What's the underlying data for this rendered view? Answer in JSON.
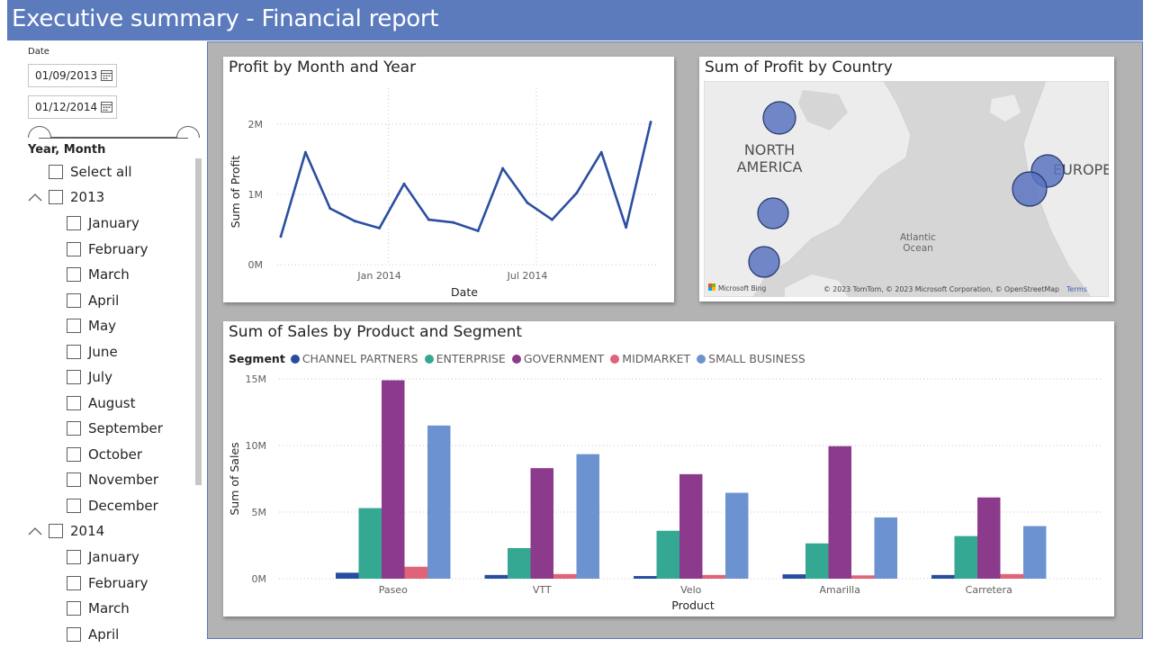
{
  "header": {
    "title": "Executive summary - Financial report"
  },
  "slicer": {
    "date_label": "Date",
    "start_date": "01/09/2013",
    "end_date": "01/12/2014",
    "year_month_label": "Year, Month",
    "select_all": "Select all",
    "years": [
      {
        "year": "2013",
        "months": [
          "January",
          "February",
          "March",
          "April",
          "May",
          "June",
          "July",
          "August",
          "September",
          "October",
          "November",
          "December"
        ]
      },
      {
        "year": "2014",
        "months": [
          "January",
          "February",
          "March",
          "April"
        ]
      }
    ]
  },
  "profit_line": {
    "title": "Profit by Month and Year",
    "chart_data": {
      "type": "line",
      "title": "Profit by Month and Year",
      "xlabel": "Date",
      "ylabel": "Sum of Profit",
      "x": [
        "2013-09",
        "2013-10",
        "2013-11",
        "2013-12",
        "2014-01",
        "2014-02",
        "2014-03",
        "2014-04",
        "2014-05",
        "2014-06",
        "2014-07",
        "2014-08",
        "2014-09",
        "2014-10",
        "2014-11",
        "2014-12"
      ],
      "x_ticks": [
        "Jan 2014",
        "Jul 2014"
      ],
      "y_ticks": [
        "0M",
        "1M",
        "2M"
      ],
      "ylim": [
        0,
        2200000
      ],
      "values": [
        400000,
        1600000,
        800000,
        620000,
        520000,
        1150000,
        640000,
        600000,
        480000,
        1370000,
        880000,
        640000,
        1020000,
        1600000,
        530000,
        2030000
      ],
      "color": "#2b4fa0",
      "grid": true
    }
  },
  "profit_map": {
    "title": "Sum of Profit by Country",
    "labels": {
      "north_america": [
        "NORTH",
        "AMERICA"
      ],
      "europe": "EUROPE",
      "ocean": [
        "Atlantic",
        "Ocean"
      ]
    },
    "attribution": "© 2023 TomTom, © 2023 Microsoft Corporation, © OpenStreetMap",
    "terms": "Terms",
    "bing": "Microsoft Bing",
    "bubble_color": "#5b74bf"
  },
  "sales_bar": {
    "title": "Sum of Sales by Product and Segment",
    "legend_title": "Segment",
    "chart_data": {
      "type": "bar",
      "title": "Sum of Sales by Product and Segment",
      "xlabel": "Product",
      "ylabel": "Sum of Sales",
      "categories": [
        "Paseo",
        "VTT",
        "Velo",
        "Amarilla",
        "Carretera"
      ],
      "y_ticks": [
        "0M",
        "5M",
        "10M",
        "15M"
      ],
      "ylim": [
        0,
        15000000
      ],
      "grid": true,
      "legend": "top-left",
      "series": [
        {
          "name": "CHANNEL PARTNERS",
          "color": "#264ea0",
          "values": [
            450000,
            280000,
            200000,
            330000,
            280000
          ]
        },
        {
          "name": "ENTERPRISE",
          "color": "#34a893",
          "values": [
            5300000,
            2300000,
            3600000,
            2650000,
            3200000
          ]
        },
        {
          "name": "GOVERNMENT",
          "color": "#8c3a8c",
          "values": [
            14900000,
            8300000,
            7850000,
            9950000,
            6100000
          ]
        },
        {
          "name": "MIDMARKET",
          "color": "#e06478",
          "values": [
            900000,
            350000,
            280000,
            250000,
            350000
          ]
        },
        {
          "name": "SMALL BUSINESS",
          "color": "#6c93cf",
          "values": [
            11500000,
            9350000,
            6450000,
            4600000,
            3950000
          ]
        }
      ]
    }
  }
}
